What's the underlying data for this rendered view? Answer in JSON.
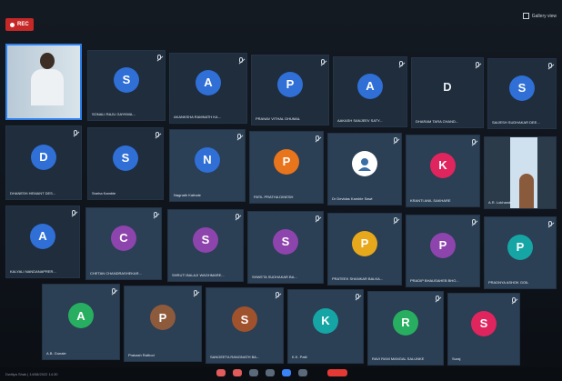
{
  "topbar": {
    "rec_label": "REC",
    "view_label": "Gallery view"
  },
  "tiles": {
    "t1": {
      "name": ""
    },
    "t2": {
      "letter": "S",
      "name": "SONALI RAJU GAYKWA...",
      "color": "#2f6fd6"
    },
    "t3": {
      "letter": "A",
      "name": "AKANKSHA RAMNATH KA...",
      "color": "#2f6fd6"
    },
    "t4": {
      "letter": "P",
      "name": "PRANAV VITHAL DHUMAL",
      "color": "#2f6fd6"
    },
    "t5": {
      "letter": "A",
      "name": "AAKASH SANJEEV SATY...",
      "color": "#2f6fd6"
    },
    "t6": {
      "letter": "D",
      "name": "DHARAM TARA CHAND...",
      "color": "#1f2d3d"
    },
    "t7": {
      "letter": "S",
      "name": "SAIJESH SUDHAKAR DEE...",
      "color": "#2f6fd6"
    },
    "t8": {
      "letter": "D",
      "name": "DHANESH HEMANT DES...",
      "color": "#2f6fd6"
    },
    "t9": {
      "letter": "S",
      "name": "Sneha Kamble",
      "color": "#2f6fd6"
    },
    "t10": {
      "letter": "N",
      "name": "Nagnath Kathale",
      "color": "#2f6fd6"
    },
    "t11": {
      "letter": "P",
      "name": "PATIL PRATHA DINESH",
      "color": "#e8741c"
    },
    "t12": {
      "letter": "",
      "name": "Dr Devidas Kamble Sawt",
      "color": "#ffffff"
    },
    "t13": {
      "letter": "K",
      "name": "KRANTI ANIL SAKHARE",
      "color": "#e0245e"
    },
    "t14": {
      "name": "A.R. Lokhande"
    },
    "t15": {
      "letter": "A",
      "name": "KALYALI NANDANAPRER...",
      "color": "#2f6fd6"
    },
    "t16": {
      "letter": "C",
      "name": "CHETAN CHANDRASHEKAR...",
      "color": "#8e44ad"
    },
    "t17": {
      "letter": "S",
      "name": "SHRUTI BALAJI WAGHMARE...",
      "color": "#8e44ad"
    },
    "t18": {
      "letter": "S",
      "name": "SHWETA SUDHAKAR BA...",
      "color": "#8e44ad"
    },
    "t19": {
      "letter": "P",
      "name": "PRATEEK SHANKAR BALKA...",
      "color": "#e8a81c"
    },
    "t20": {
      "letter": "P",
      "name": "PRADIP BHAUSAHEB BHO...",
      "color": "#8e44ad"
    },
    "t21": {
      "letter": "P",
      "name": "PRADNYA ASHOK GOIL",
      "color": "#16a5a5"
    },
    "t22": {
      "letter": "A",
      "name": "A.B. Gunale",
      "color": "#27ae60"
    },
    "t23": {
      "letter": "P",
      "name": "Prakash Rathod",
      "color": "#8e5a3c"
    },
    "t24": {
      "letter": "S",
      "name": "SANGEETA RANGNATH BA...",
      "color": "#a0522d"
    },
    "t25": {
      "letter": "K",
      "name": "K.K. Patil",
      "color": "#16a5a5"
    },
    "t26": {
      "letter": "R",
      "name": "RAVI RANI MANGAL SALUNKE",
      "color": "#27ae60"
    },
    "t27": {
      "letter": "S",
      "name": "Suraj",
      "color": "#e0245e"
    }
  },
  "bottombar": {
    "status_text": "Dwitiya Shak  |  14/08/2022 14:30"
  }
}
